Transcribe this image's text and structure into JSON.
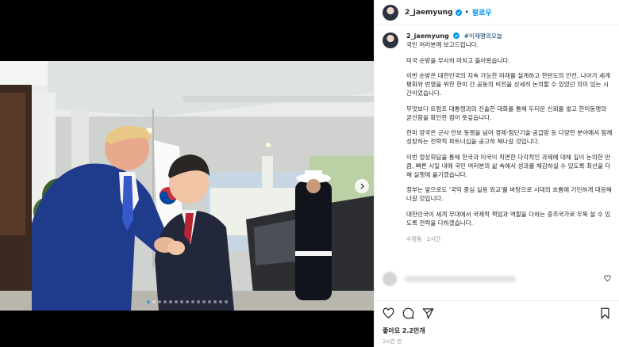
{
  "post": {
    "username": "2_jaemyung",
    "follow_label": "팔로우",
    "separator": "•",
    "hashtag": "#이재명의오늘",
    "paragraphs": [
      "국민 여러분께 보고드립니다.",
      "미국 순방을 무사히 마치고 돌아왔습니다.",
      "이번 순방은 대한민국의 지속 가능한 미래를 설계하고 한반도의 안전, 나아가 세계 평화와 번영을 위한 한미 간 공동의 비전을 상세히 논의할 수 있었던 의미 있는 시간이었습니다.",
      "무엇보다 트럼프 대통령과의 진솔한 대화를 통해 두터운 신뢰를 쌓고 한미동맹의 굳건함을 확인한 점이 뜻깊습니다.",
      "한미 양국은 군사·안보 동맹을 넘어 경제·첨단기술·공급망 등 다양한 분야에서 함께 성장하는 전략적 파트너십을 공고히 해나갈 것입니다.",
      "이번 정상회담을 통해 한국과 미국이 직면한 다각적인 과제에 대해 깊이 논의한 만큼, 빠른 시일 내에 국민 여러분의 삶 속에서 성과를 체감하실 수 있도록 최선을 다해 실행에 옮기겠습니다.",
      "정부는 앞으로도 '국익 중심 실용 외교'를 바탕으로 시대의 흐름에 기민하게 대응해 나갈 것입니다.",
      "대한민국이 세계 무대에서 국제적 책임과 역할을 다하는 중추국가로 우뚝 설 수 있도록 전력을 다하겠습니다."
    ],
    "caption_meta": "수정됨 · 2시간",
    "likes": "좋아요 2.2만개",
    "time_ago": "2시간 전"
  },
  "carousel": {
    "count": 15,
    "active_index": 0
  },
  "colors": {
    "accent": "#0095f6",
    "verified": "#0095f6",
    "active_dot": "#3797f0"
  },
  "icons": [
    "verified-badge-icon",
    "heart-icon",
    "comment-icon",
    "share-icon",
    "bookmark-icon",
    "chevron-right-icon"
  ]
}
